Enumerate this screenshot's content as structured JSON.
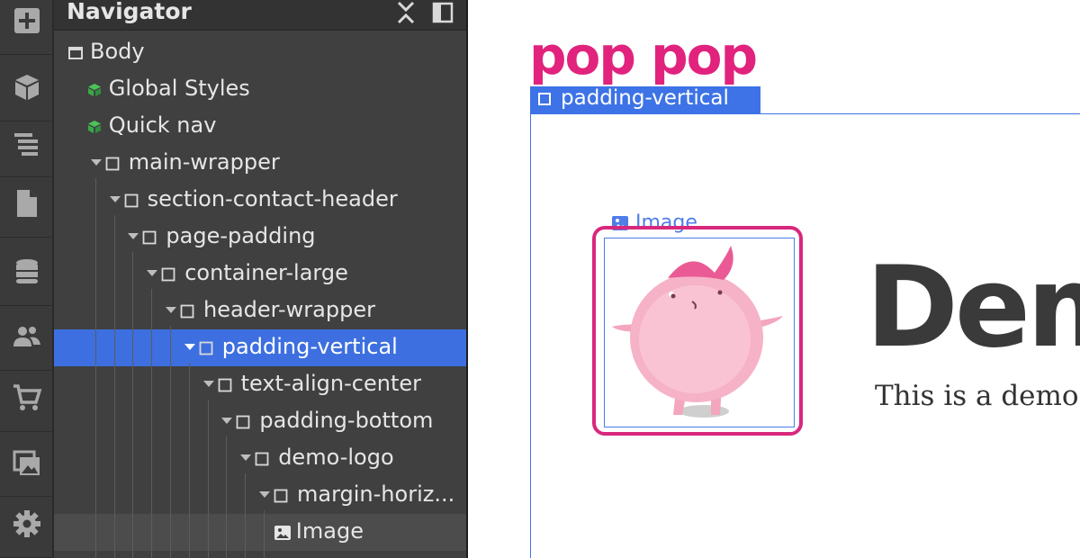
{
  "app": {
    "accent_color": "#3d6fe0",
    "brand_color": "#e1237d"
  },
  "rail": {
    "items": [
      {
        "name": "add-icon"
      },
      {
        "name": "components-icon"
      },
      {
        "name": "navigator-icon"
      },
      {
        "name": "pages-icon"
      },
      {
        "name": "cms-icon"
      },
      {
        "name": "users-icon"
      },
      {
        "name": "ecommerce-icon"
      },
      {
        "name": "assets-icon"
      },
      {
        "name": "settings-icon"
      }
    ]
  },
  "navigator": {
    "title": "Navigator",
    "close_icon": "collapse-icon",
    "dock_icon": "dock-panel-icon",
    "tree": [
      {
        "label": "Body",
        "icon": "body-icon",
        "depth": 0,
        "caret": false
      },
      {
        "label": "Global Styles",
        "icon": "component-icon",
        "depth": 1,
        "caret": false
      },
      {
        "label": "Quick nav",
        "icon": "component-icon",
        "depth": 1,
        "caret": false
      },
      {
        "label": "main-wrapper",
        "icon": "div-icon",
        "depth": 1,
        "caret": true
      },
      {
        "label": "section-contact-header",
        "icon": "div-icon",
        "depth": 2,
        "caret": true
      },
      {
        "label": "page-padding",
        "icon": "div-icon",
        "depth": 3,
        "caret": true
      },
      {
        "label": "container-large",
        "icon": "div-icon",
        "depth": 4,
        "caret": true
      },
      {
        "label": "header-wrapper",
        "icon": "div-icon",
        "depth": 5,
        "caret": true
      },
      {
        "label": "padding-vertical",
        "icon": "div-icon",
        "depth": 6,
        "caret": true,
        "selected": true
      },
      {
        "label": "text-align-center",
        "icon": "div-icon",
        "depth": 7,
        "caret": true
      },
      {
        "label": "padding-bottom",
        "icon": "div-icon",
        "depth": 8,
        "caret": true
      },
      {
        "label": "demo-logo",
        "icon": "div-icon",
        "depth": 9,
        "caret": true
      },
      {
        "label": "margin-horiz...",
        "icon": "div-icon",
        "depth": 10,
        "caret": true
      },
      {
        "label": "Image",
        "icon": "image-icon",
        "depth": 11,
        "caret": false,
        "hovered": true
      }
    ]
  },
  "canvas": {
    "logo_text": "pop pop",
    "selection_tag": "padding-vertical",
    "image_tag": "Image",
    "heading": "Dem",
    "subtext": "This is a demo"
  }
}
